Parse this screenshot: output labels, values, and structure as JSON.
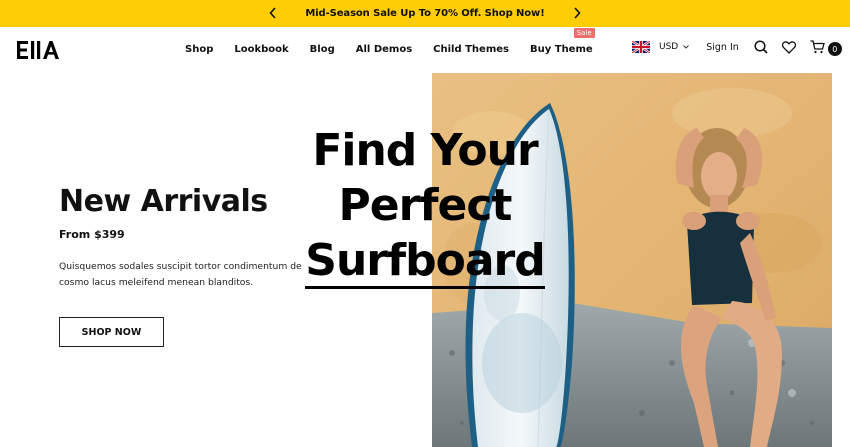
{
  "announcement": {
    "text": "Mid-Season Sale Up To 70% Off. Shop Now!",
    "prev_icon": "chevron-left-icon",
    "next_icon": "chevron-right-icon",
    "background": "#ffcd05"
  },
  "header": {
    "logo": "EllA",
    "nav": [
      {
        "label": "Shop"
      },
      {
        "label": "Lookbook"
      },
      {
        "label": "Blog"
      },
      {
        "label": "All Demos"
      },
      {
        "label": "Child Themes"
      },
      {
        "label": "Buy Theme",
        "badge": "Sale"
      }
    ],
    "currency": "USD",
    "flag": "uk-flag-icon",
    "signin": "Sign In",
    "cart_count": "0",
    "icons": [
      "search-icon",
      "heart-icon",
      "cart-icon"
    ]
  },
  "hero": {
    "title": "New Arrivals",
    "price": "From $399",
    "description": "Quisquemos sodales suscipit tortor condimentum de cosmo lacus meleifend menean blanditos.",
    "button": "SHOP NOW",
    "headline": {
      "line1": "Find Your",
      "line2": "Perfect",
      "line3": "Surfboard"
    },
    "badge_color": "#f06d6d"
  }
}
